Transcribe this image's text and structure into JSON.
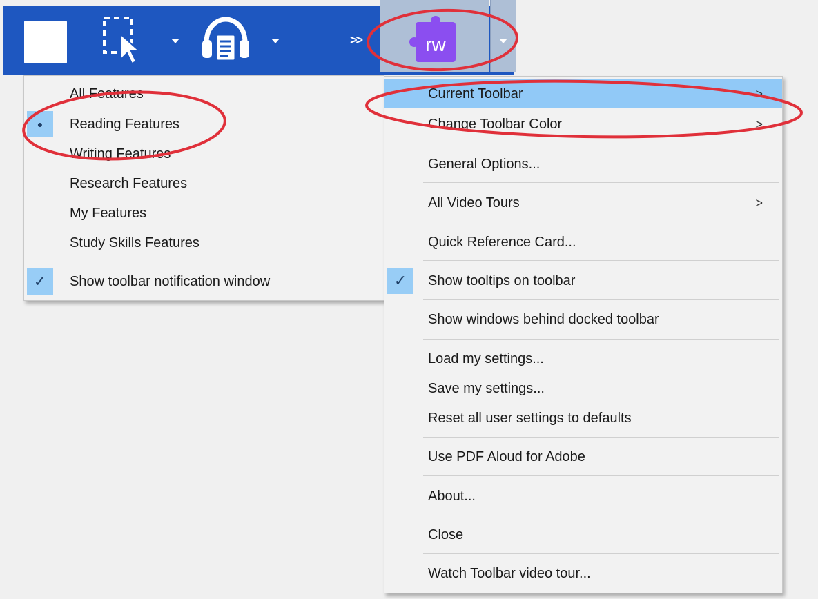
{
  "toolbar": {
    "overflow_label": ">>",
    "rw_logo_text": "rw",
    "colors": {
      "bar": "#1e57c0",
      "rw_button": "#aebfd6",
      "rw_logo": "#8b4ef0"
    }
  },
  "left_menu": {
    "items": [
      {
        "label": "All Features"
      },
      {
        "label": "Reading Features",
        "selected": true,
        "mark": "●"
      },
      {
        "label": "Writing Features"
      },
      {
        "label": "Research Features"
      },
      {
        "label": "My Features"
      },
      {
        "label": "Study Skills Features"
      },
      {
        "label": "Show toolbar notification window",
        "checked": true,
        "mark": "✓"
      }
    ]
  },
  "right_menu": {
    "items": [
      {
        "label": "Current Toolbar",
        "submenu": true,
        "highlighted": true
      },
      {
        "label": "Change Toolbar Color",
        "submenu": true
      },
      {
        "label": "General Options..."
      },
      {
        "label": "All Video Tours",
        "submenu": true
      },
      {
        "label": "Quick Reference Card..."
      },
      {
        "label": "Show tooltips on toolbar",
        "checked": true,
        "mark": "✓"
      },
      {
        "label": "Show windows behind docked toolbar"
      },
      {
        "label": "Load my settings..."
      },
      {
        "label": "Save my settings..."
      },
      {
        "label": "Reset all user settings to defaults"
      },
      {
        "label": "Use PDF Aloud for Adobe"
      },
      {
        "label": "About..."
      },
      {
        "label": "Close"
      },
      {
        "label": "Watch Toolbar video tour..."
      }
    ],
    "chevron": ">"
  },
  "annotation_color": "#e0303a"
}
